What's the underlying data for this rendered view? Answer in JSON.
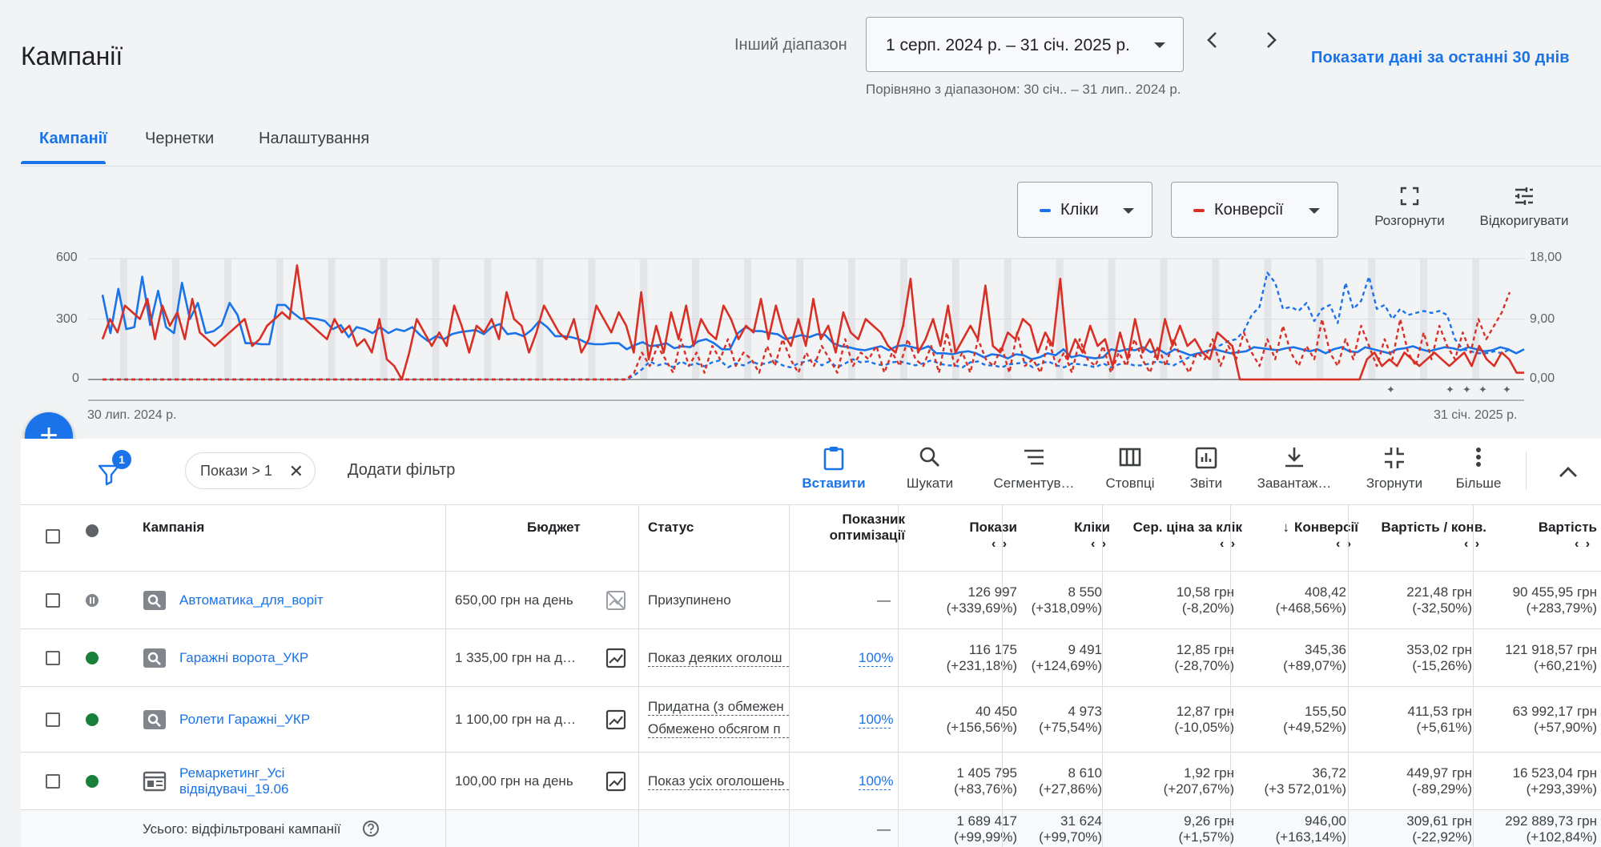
{
  "header": {
    "title": "Кампанії",
    "range_label": "Інший діапазон",
    "date_range": "1 серп. 2024 р. – 31 січ. 2025 р.",
    "compare_text": "Порівняно з діапазоном: 30 січ.. – 31 лип.. 2024 р.",
    "last30_link": "Показати дані за останні 30 днів"
  },
  "tabs": [
    {
      "label": "Кампанії",
      "active": true
    },
    {
      "label": "Чернетки",
      "active": false
    },
    {
      "label": "Налаштування",
      "active": false
    }
  ],
  "chart_controls": {
    "metric1": {
      "label": "Кліки",
      "color": "#1a73e8"
    },
    "metric2": {
      "label": "Конверсії",
      "color": "#d93025"
    },
    "expand_label": "Розгорнути",
    "adjust_label": "Відкоригувати"
  },
  "chart_data": {
    "type": "line",
    "x_start_label": "30 лип. 2024 р.",
    "x_end_label": "31 січ. 2025 р.",
    "y_left_ticks": [
      "600",
      "300",
      "0"
    ],
    "y_right_ticks": [
      "18,00",
      "9,00",
      "0,00"
    ],
    "y_left_range": [
      0,
      600
    ],
    "y_right_range": [
      0,
      18
    ],
    "grid": true,
    "series": [
      {
        "name": "Кліки",
        "axis": "left",
        "color": "#1a73e8",
        "style": "solid",
        "values": [
          420,
          230,
          450,
          250,
          260,
          510,
          270,
          440,
          260,
          230,
          480,
          300,
          380,
          230,
          240,
          270,
          380,
          320,
          180,
          180,
          175,
          175,
          370,
          370,
          330,
          300,
          305,
          300,
          290,
          250,
          270,
          210,
          260,
          250,
          230,
          260,
          230,
          250,
          240,
          260,
          220,
          190,
          215,
          200,
          225,
          235,
          240,
          245,
          225,
          260,
          275,
          225,
          230,
          215,
          245,
          290,
          260,
          215,
          215,
          210,
          200,
          180,
          175,
          175,
          180,
          180,
          150,
          170,
          185,
          165,
          170,
          180,
          155,
          165,
          160,
          190,
          200,
          180,
          150,
          150,
          230,
          260,
          240,
          240,
          230,
          225,
          200,
          210,
          220,
          210,
          225,
          220,
          180,
          165,
          160,
          150,
          145,
          155,
          165,
          145,
          165,
          170,
          160,
          150,
          165,
          130,
          130,
          125,
          135,
          140,
          130,
          110,
          125,
          120,
          105,
          125,
          120,
          100,
          110,
          130,
          120,
          150,
          110,
          120,
          110,
          105,
          110,
          150,
          140,
          150,
          145,
          160,
          135,
          150,
          125,
          150,
          135,
          120,
          130,
          140,
          150,
          140,
          130,
          135,
          140,
          160,
          155,
          150,
          145,
          155,
          160,
          150,
          140,
          150,
          130,
          150,
          160,
          140,
          135,
          160,
          150,
          140,
          130,
          150,
          155,
          165,
          150,
          140,
          150,
          160,
          155,
          145,
          160,
          150,
          140,
          145,
          160,
          150,
          130,
          150
        ]
      },
      {
        "name": "Кліки (попередній період)",
        "axis": "left",
        "color": "#1a73e8",
        "style": "dashed",
        "values": [
          0,
          0,
          0,
          0,
          0,
          0,
          0,
          0,
          0,
          0,
          0,
          0,
          0,
          0,
          0,
          0,
          0,
          0,
          0,
          0,
          0,
          0,
          0,
          0,
          0,
          0,
          0,
          0,
          0,
          0,
          0,
          0,
          0,
          0,
          0,
          0,
          0,
          0,
          0,
          0,
          0,
          0,
          0,
          0,
          0,
          0,
          0,
          0,
          0,
          0,
          0,
          0,
          0,
          0,
          0,
          0,
          0,
          0,
          0,
          0,
          0,
          0,
          0,
          0,
          0,
          0,
          0,
          0,
          20,
          50,
          90,
          70,
          80,
          60,
          90,
          70,
          80,
          65,
          85,
          95,
          60,
          80,
          70,
          90,
          75,
          80,
          95,
          70,
          60,
          80,
          90,
          100,
          70,
          90,
          60,
          80,
          100,
          85,
          90,
          75,
          70,
          85,
          90,
          80,
          70,
          80,
          95,
          80,
          70,
          70,
          60,
          85,
          90,
          70,
          70,
          60,
          75,
          80,
          85,
          60,
          80,
          90,
          70,
          60,
          80,
          75,
          70,
          60,
          80,
          60,
          75,
          80,
          70,
          70,
          80,
          90,
          80,
          70,
          90,
          110,
          120,
          140,
          150,
          170,
          190,
          200,
          240,
          320,
          360,
          530,
          480,
          350,
          360,
          340,
          380,
          290,
          350,
          370,
          280,
          480,
          350,
          390,
          510,
          350,
          370,
          300,
          350,
          320,
          330,
          340,
          330,
          340,
          320,
          200,
          150,
          140,
          130,
          130,
          140,
          130,
          150
        ]
      },
      {
        "name": "Конверсії",
        "axis": "right",
        "color": "#d93025",
        "style": "solid",
        "values": [
          6,
          9,
          7,
          11,
          10,
          9,
          12,
          6,
          11,
          8,
          10,
          6,
          12,
          7,
          6,
          5,
          6,
          7,
          8,
          9,
          5,
          6,
          8,
          9,
          10,
          9,
          17,
          9,
          8,
          7,
          6,
          9,
          7,
          8,
          5,
          6,
          4,
          9,
          3,
          2,
          0,
          4,
          9,
          7,
          5,
          7,
          5,
          11,
          8,
          4,
          8,
          7,
          9,
          6,
          13,
          9,
          8,
          4,
          7,
          11,
          9,
          7,
          6,
          9,
          4,
          6,
          11,
          9,
          7,
          10,
          8,
          4,
          13,
          3,
          8,
          4,
          10,
          6,
          11,
          5,
          9,
          7,
          6,
          11,
          9,
          6,
          8,
          7,
          12,
          6,
          11,
          7,
          5,
          9,
          5,
          12,
          6,
          8,
          4,
          10,
          7,
          6,
          9,
          8,
          7,
          5,
          4,
          8,
          15,
          4,
          6,
          9,
          5,
          11,
          4,
          6,
          8,
          6,
          14,
          5,
          4,
          7,
          6,
          9,
          8,
          4,
          7,
          5,
          15,
          3,
          6,
          4,
          8,
          5,
          6,
          2,
          7,
          3,
          9,
          4,
          6,
          3,
          9,
          5,
          8,
          5,
          6,
          4,
          3,
          7,
          6,
          5,
          0,
          0,
          0,
          0,
          0,
          0,
          0,
          0,
          0,
          0,
          0,
          0,
          0,
          0,
          0,
          0,
          0,
          3,
          4,
          2,
          3,
          2,
          4,
          3,
          2,
          3,
          4,
          3,
          2,
          3,
          4,
          2,
          5,
          3,
          2,
          4,
          3,
          1,
          1
        ]
      },
      {
        "name": "Конверсії (попередній період)",
        "axis": "right",
        "color": "#d93025",
        "style": "dashed",
        "values": [
          0,
          0,
          0,
          0,
          0,
          0,
          0,
          0,
          0,
          0,
          0,
          0,
          0,
          0,
          0,
          0,
          0,
          0,
          0,
          0,
          0,
          0,
          0,
          0,
          0,
          0,
          0,
          0,
          0,
          0,
          0,
          0,
          0,
          0,
          0,
          0,
          0,
          0,
          0,
          0,
          0,
          0,
          0,
          0,
          0,
          0,
          0,
          0,
          0,
          0,
          0,
          0,
          0,
          0,
          0,
          0,
          0,
          0,
          0,
          0,
          0,
          0,
          0,
          0,
          0,
          0,
          0,
          0,
          1,
          4,
          2,
          5,
          3,
          1,
          6,
          2,
          4,
          1,
          5,
          3,
          6,
          2,
          4,
          3,
          1,
          5,
          2,
          6,
          3,
          1,
          4,
          2,
          5,
          3,
          1,
          6,
          2,
          4,
          3,
          5,
          1,
          4,
          2,
          6,
          3,
          2,
          5,
          1,
          7,
          2,
          4,
          1,
          6,
          3,
          2,
          5,
          1,
          7,
          2,
          3,
          1,
          6,
          2,
          4,
          1,
          6,
          3,
          2,
          5,
          1,
          4,
          2,
          6,
          3,
          1,
          5,
          2,
          6,
          3,
          1,
          4,
          3,
          6,
          2,
          5,
          3,
          7,
          4,
          2,
          6,
          3,
          8,
          4,
          2,
          5,
          3,
          9,
          4,
          2,
          6,
          3,
          8,
          5,
          2,
          6,
          3,
          9,
          4,
          2,
          7,
          3,
          8,
          5,
          3,
          7,
          4,
          9,
          6,
          8,
          10,
          13
        ]
      }
    ]
  },
  "fab_label": "+",
  "filter": {
    "badge": "1",
    "chip_label": "Покази > 1",
    "add_filter": "Додати фільтр"
  },
  "toolbar": [
    {
      "label": "Вставити",
      "icon": "clipboard-icon",
      "active": true
    },
    {
      "label": "Шукати",
      "icon": "search-icon",
      "active": false
    },
    {
      "label": "Сегментув…",
      "icon": "segment-icon",
      "active": false
    },
    {
      "label": "Стовпці",
      "icon": "columns-icon",
      "active": false
    },
    {
      "label": "Звіти",
      "icon": "reports-icon",
      "active": false
    },
    {
      "label": "Завантаж…",
      "icon": "download-icon",
      "active": false
    },
    {
      "label": "Згорнути",
      "icon": "collapse-icon",
      "active": false
    },
    {
      "label": "Більше",
      "icon": "more-icon",
      "active": false
    }
  ],
  "table": {
    "headers": {
      "campaign": "Кампанія",
      "budget": "Бюджет",
      "status": "Статус",
      "opt_line1": "Показник",
      "opt_line2": "оптимізації",
      "impressions": "Покази",
      "clicks": "Кліки",
      "avg_cpc": "Сер. ціна за клік",
      "conversions": "Конверсії",
      "cost_conv": "Вартість / конв.",
      "cost": "Вартість",
      "sort_arrows": "‹›",
      "sort_down": "↓"
    },
    "rows": [
      {
        "name": "Автоматика_для_воріт",
        "name2": "",
        "status_dot": "paused",
        "type_icon": "search-campaign-icon",
        "budget": "650,00 грн на день",
        "status1": "Призупинено",
        "status2": "",
        "opt": "—",
        "impr": "126 997",
        "impr_d": "(+339,69%)",
        "clicks": "8 550",
        "clicks_d": "(+318,09%)",
        "cpc": "10,58 грн",
        "cpc_d": "(-8,20%)",
        "conv": "408,42",
        "conv_d": "(+468,56%)",
        "cpc_conv": "221,48 грн",
        "cpc_conv_d": "(-32,50%)",
        "cost": "90 455,95 грн",
        "cost_d": "(+283,79%)"
      },
      {
        "name": "Гаражні ворота_УКР",
        "name2": "",
        "status_dot": "active",
        "type_icon": "search-campaign-icon",
        "budget": "1 335,00 грн на д…",
        "status1": "Показ деяких оголош",
        "status2": "",
        "opt": "100%",
        "impr": "116 175",
        "impr_d": "(+231,18%)",
        "clicks": "9 491",
        "clicks_d": "(+124,69%)",
        "cpc": "12,85 грн",
        "cpc_d": "(-28,70%)",
        "conv": "345,36",
        "conv_d": "(+89,07%)",
        "cpc_conv": "353,02 грн",
        "cpc_conv_d": "(-15,26%)",
        "cost": "121 918,57 грн",
        "cost_d": "(+60,21%)"
      },
      {
        "name": "Ролети Гаражні_УКР",
        "name2": "",
        "status_dot": "active",
        "type_icon": "search-campaign-icon",
        "budget": "1 100,00 грн на д…",
        "status1": "Придатна (з обмежен",
        "status2": "Обмежено обсягом п",
        "opt": "100%",
        "impr": "40 450",
        "impr_d": "(+156,56%)",
        "clicks": "4 973",
        "clicks_d": "(+75,54%)",
        "cpc": "12,87 грн",
        "cpc_d": "(-10,05%)",
        "conv": "155,50",
        "conv_d": "(+49,52%)",
        "cpc_conv": "411,53 грн",
        "cpc_conv_d": "(+5,61%)",
        "cost": "63 992,17 грн",
        "cost_d": "(+57,90%)"
      },
      {
        "name": "Ремаркетинг_Усі",
        "name2": "відвідувачі_19.06",
        "status_dot": "active",
        "type_icon": "display-campaign-icon",
        "budget": "100,00 грн на день",
        "status1": "Показ усіх оголошень",
        "status2": "",
        "opt": "100%",
        "impr": "1 405 795",
        "impr_d": "(+83,76%)",
        "clicks": "8 610",
        "clicks_d": "(+27,86%)",
        "cpc": "1,92 грн",
        "cpc_d": "(+207,67%)",
        "conv": "36,72",
        "conv_d": "(+3 572,01%)",
        "cpc_conv": "449,97 грн",
        "cpc_conv_d": "(-89,29%)",
        "cost": "16 523,04 грн",
        "cost_d": "(+293,39%)"
      }
    ],
    "total": {
      "label": "Усього: відфільтровані кампанії",
      "opt": "—",
      "impr": "1 689 417",
      "impr_d": "(+99,99%)",
      "clicks": "31 624",
      "clicks_d": "(+99,70%)",
      "cpc": "9,26 грн",
      "cpc_d": "(+1,57%)",
      "conv": "946,00",
      "conv_d": "(+163,14%)",
      "cpc_conv": "309,61 грн",
      "cpc_conv_d": "(-22,92%)",
      "cost": "292 889,73 грн",
      "cost_d": "(+102,84%)"
    }
  }
}
